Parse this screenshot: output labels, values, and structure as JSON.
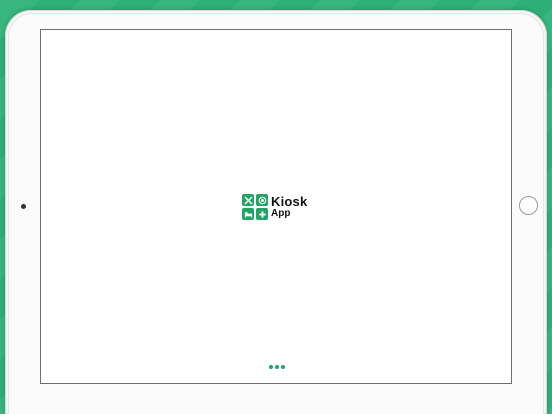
{
  "logo": {
    "line1": "Kiosk",
    "line2": "App"
  },
  "icons": {
    "tile_top_left": "tools-icon",
    "tile_top_right": "food-plate-icon",
    "tile_bottom_left": "bed-icon",
    "tile_bottom_right": "medical-cross-icon"
  },
  "colors": {
    "background": "#2fb37a",
    "brand_green": "#22a466",
    "loader_dot": "#22a466"
  },
  "loader": {
    "dots": 3
  }
}
